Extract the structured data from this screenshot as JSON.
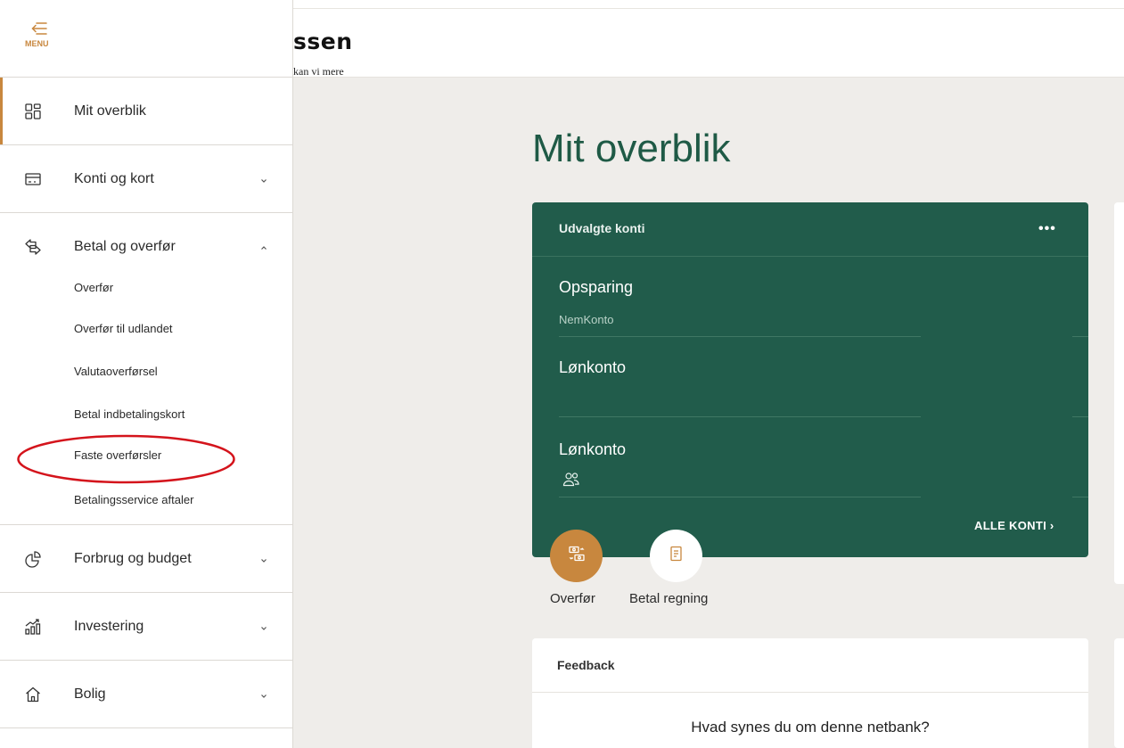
{
  "header": {
    "brand_name": "ssen",
    "brand_tagline": "kan vi mere"
  },
  "sidebar": {
    "menu_label": "MENU",
    "items": [
      {
        "label": "Mit overblik",
        "icon": "dashboard-icon"
      },
      {
        "label": "Konti og kort",
        "icon": "card-icon"
      },
      {
        "label": "Betal og overfør",
        "icon": "transfer-icon"
      },
      {
        "label": "Forbrug og budget",
        "icon": "pie-chart-icon"
      },
      {
        "label": "Investering",
        "icon": "investment-chart-icon"
      },
      {
        "label": "Bolig",
        "icon": "home-icon"
      }
    ],
    "subitems": [
      "Overfør",
      "Overfør til udlandet",
      "Valutaoverførsel",
      "Betal indbetalingskort",
      "Faste overførsler",
      "Betalingsservice aftaler"
    ],
    "highlight_color": "#d4141c"
  },
  "main": {
    "title": "Mit overblik",
    "accounts_card": {
      "title": "Udvalgte konti",
      "more_label": "•••",
      "accounts": [
        {
          "name": "Opsparing",
          "sub": "NemKonto"
        },
        {
          "name": "Lønkonto",
          "sub": ""
        },
        {
          "name": "Lønkonto",
          "sub": ""
        }
      ],
      "all_accounts_label": "ALLE KONTI ›"
    },
    "quick_actions": [
      {
        "label": "Overfør",
        "icon": "transfer-money-icon"
      },
      {
        "label": "Betal regning",
        "icon": "bill-icon"
      }
    ],
    "feedback": {
      "title": "Feedback",
      "question": "Hvad synes du om denne netbank?"
    }
  },
  "colors": {
    "accent_orange": "#c8873e",
    "card_green": "#215c4b",
    "title_green": "#1f5a46",
    "background": "#efedea"
  }
}
